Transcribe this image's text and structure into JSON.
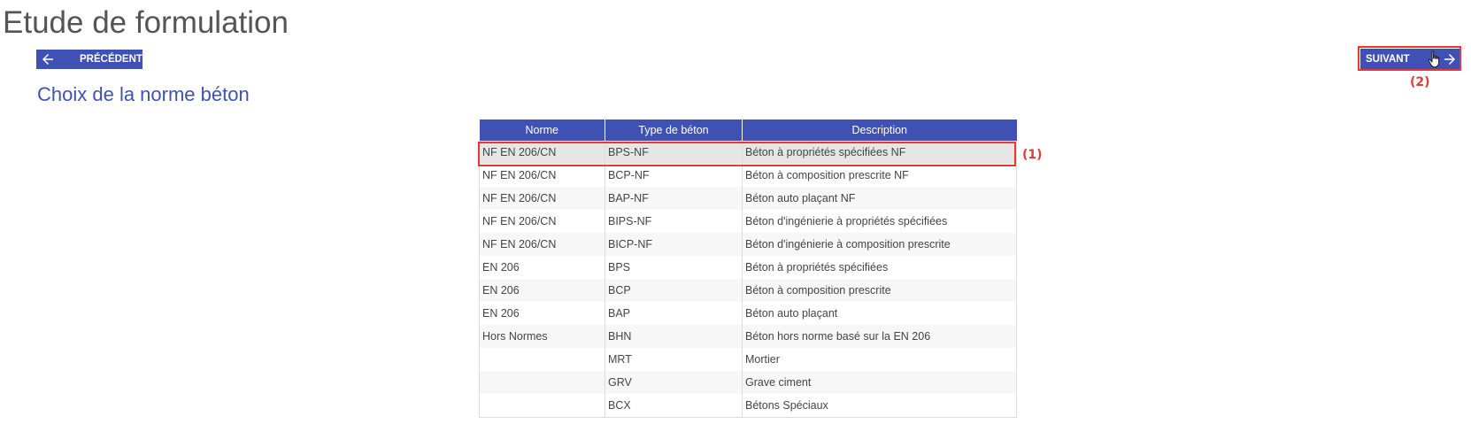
{
  "page": {
    "title": "Etude de formulation"
  },
  "nav": {
    "prev_label": "PRÉCÉDENT",
    "next_label": "SUIVANT"
  },
  "section": {
    "title": "Choix de la norme béton"
  },
  "annotations": {
    "row": "(1)",
    "next": "(2)"
  },
  "colors": {
    "primary": "#3f51b5",
    "annotation": "#e53935"
  },
  "table": {
    "headers": [
      "Norme",
      "Type de béton",
      "Description"
    ],
    "selected_row": 0,
    "rows": [
      [
        "NF EN 206/CN",
        "BPS-NF",
        "Béton à propriétés spécifiées NF"
      ],
      [
        "NF EN 206/CN",
        "BCP-NF",
        "Béton à composition prescrite NF"
      ],
      [
        "NF EN 206/CN",
        "BAP-NF",
        "Béton auto plaçant NF"
      ],
      [
        "NF EN 206/CN",
        "BIPS-NF",
        "Béton d'ingénierie à propriétés spécifiées"
      ],
      [
        "NF EN 206/CN",
        "BICP-NF",
        "Béton d'ingénierie à composition prescrite"
      ],
      [
        "EN 206",
        "BPS",
        "Béton à propriétés spécifiées"
      ],
      [
        "EN 206",
        "BCP",
        "Béton à composition prescrite"
      ],
      [
        "EN 206",
        "BAP",
        "Béton auto plaçant"
      ],
      [
        "Hors Normes",
        "BHN",
        "Béton hors norme basé sur la EN 206"
      ],
      [
        "",
        "MRT",
        "Mortier"
      ],
      [
        "",
        "GRV",
        "Grave ciment"
      ],
      [
        "",
        "BCX",
        "Bétons Spéciaux"
      ]
    ]
  }
}
